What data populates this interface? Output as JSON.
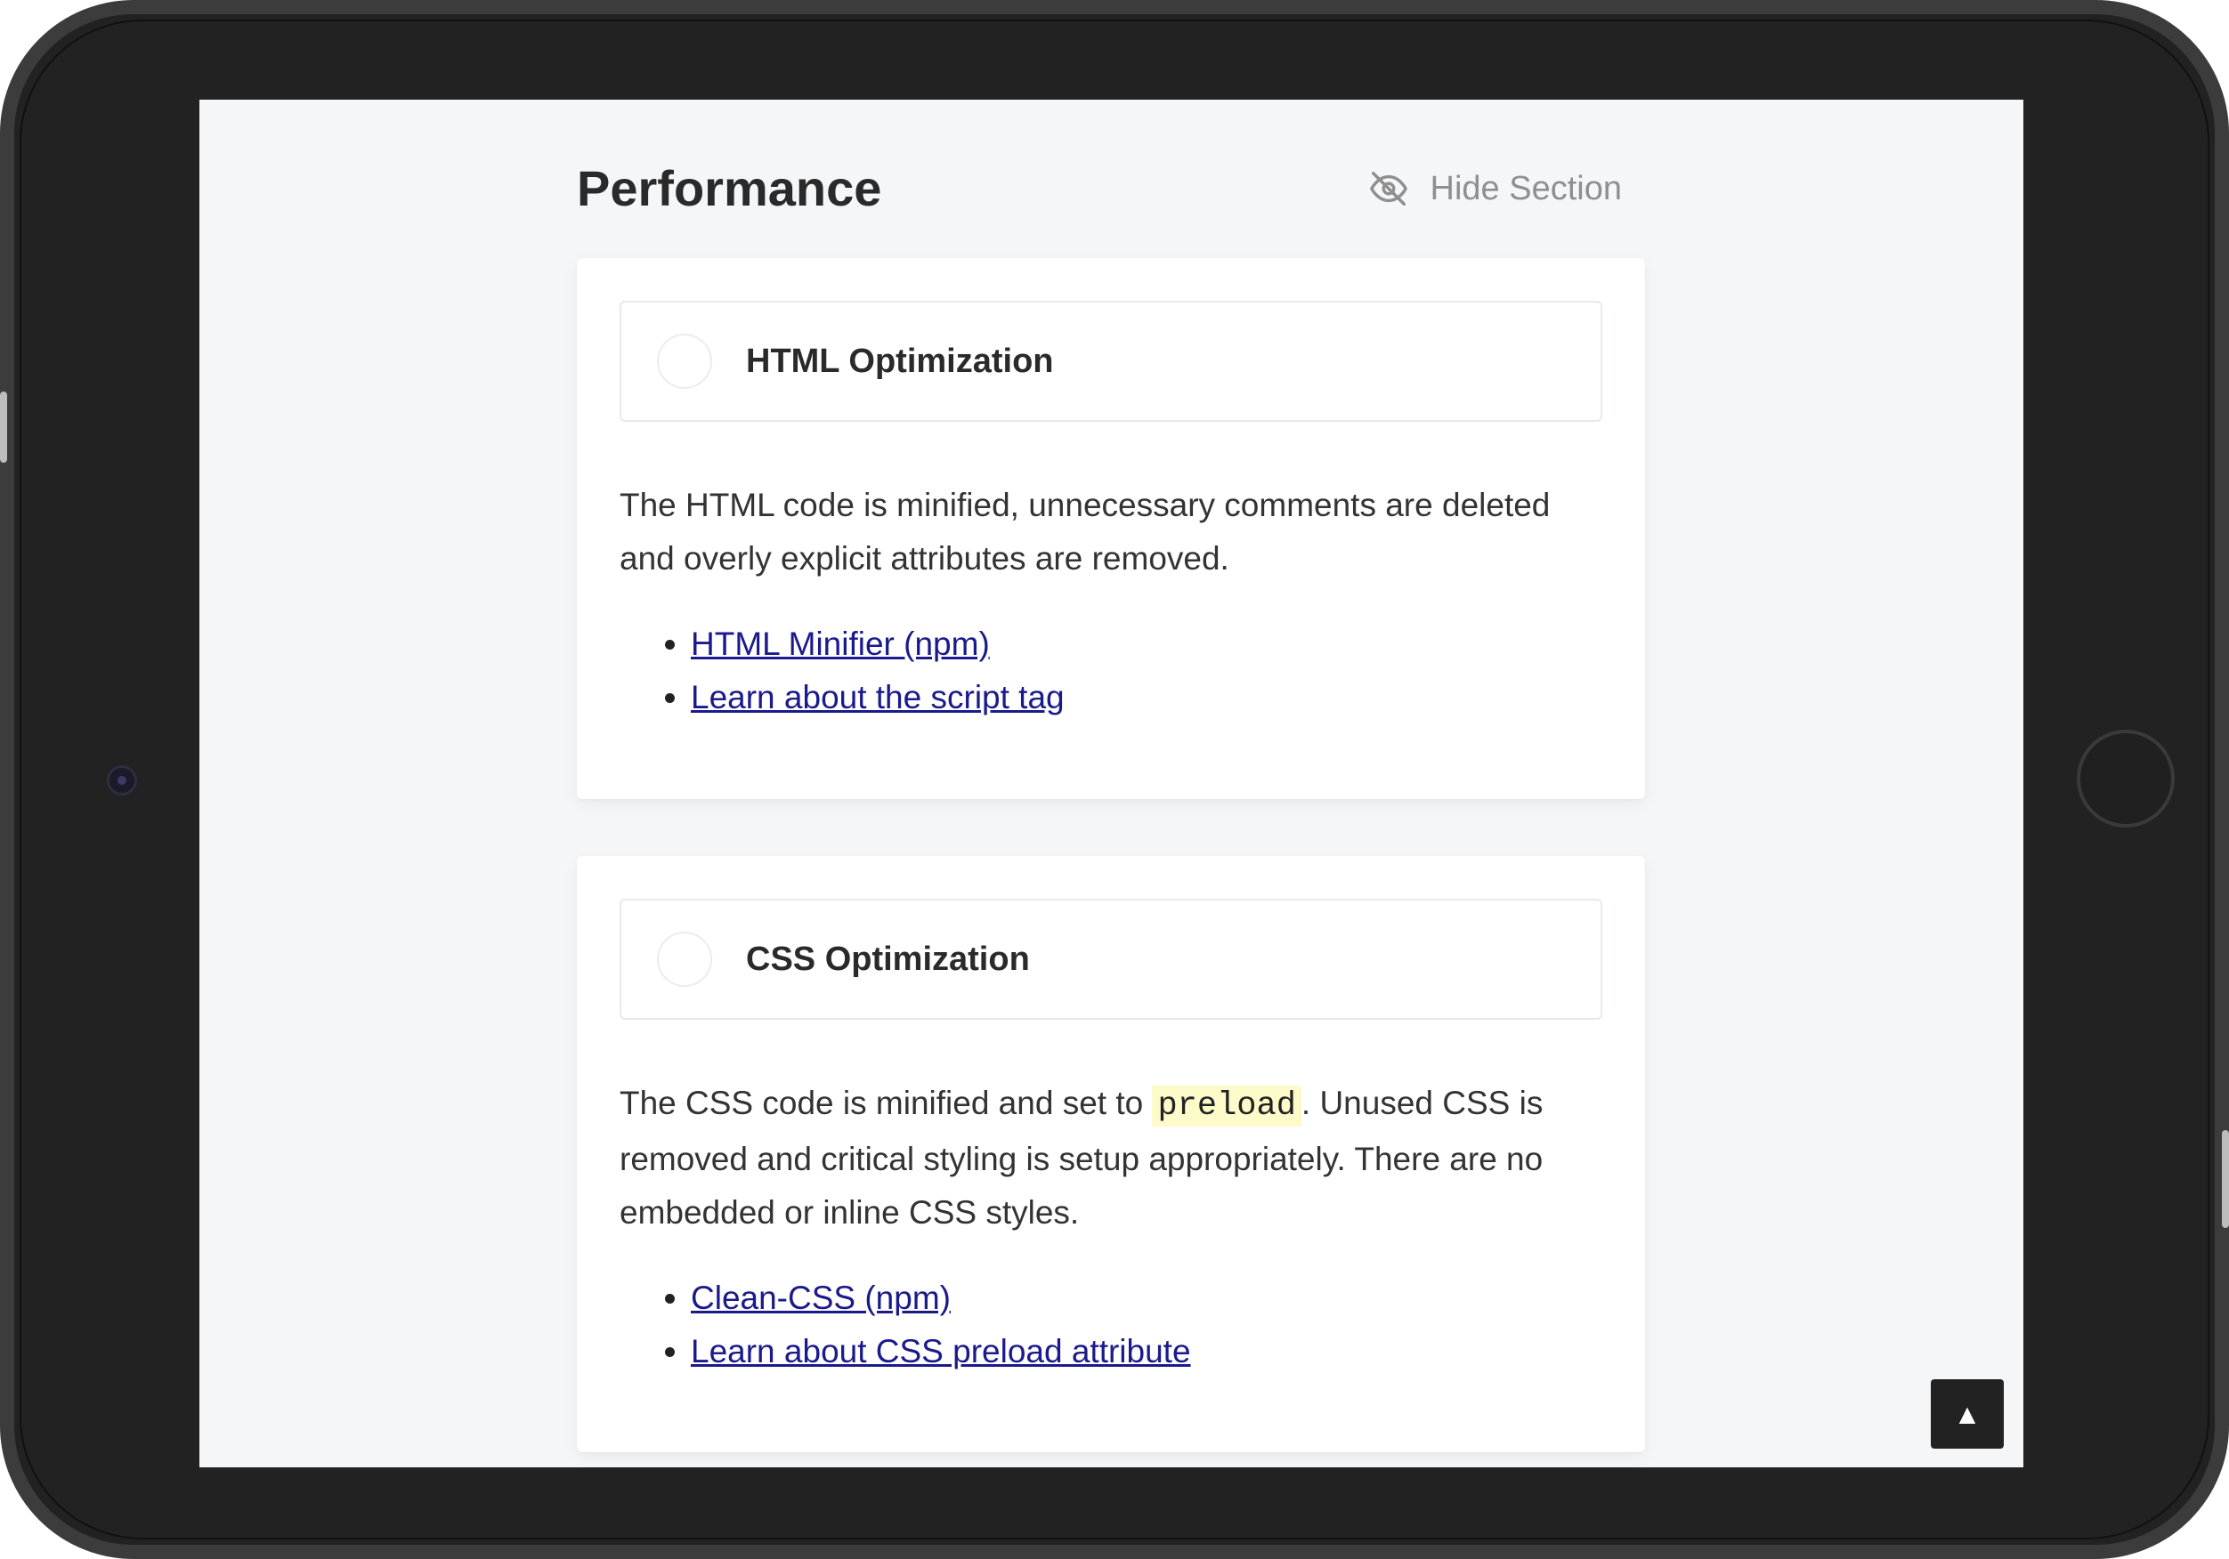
{
  "section": {
    "title": "Performance",
    "hide_label": "Hide Section"
  },
  "items": [
    {
      "title": "HTML Optimization",
      "description": "The HTML code is minified, unnecessary comments are deleted and overly explicit attributes are removed.",
      "links": [
        "HTML Minifier (npm)",
        "Learn about the script tag"
      ]
    },
    {
      "title": "CSS Optimization",
      "description_before": "The CSS code is minified and set to ",
      "description_code": "preload",
      "description_after": ". Unused CSS is removed and critical styling is setup appropriately. There are no embedded or inline CSS styles.",
      "links": [
        "Clean-CSS (npm)",
        "Learn about CSS preload attribute"
      ]
    }
  ],
  "scroll_top_label": "▲",
  "icons": {
    "hide": "eye-slash-icon",
    "scroll_top": "arrow-up-icon"
  },
  "colors": {
    "link": "#1a1a8c",
    "code_highlight": "#fdfbc9",
    "muted": "#8f8f8f",
    "screen_bg": "#f5f6f8"
  }
}
